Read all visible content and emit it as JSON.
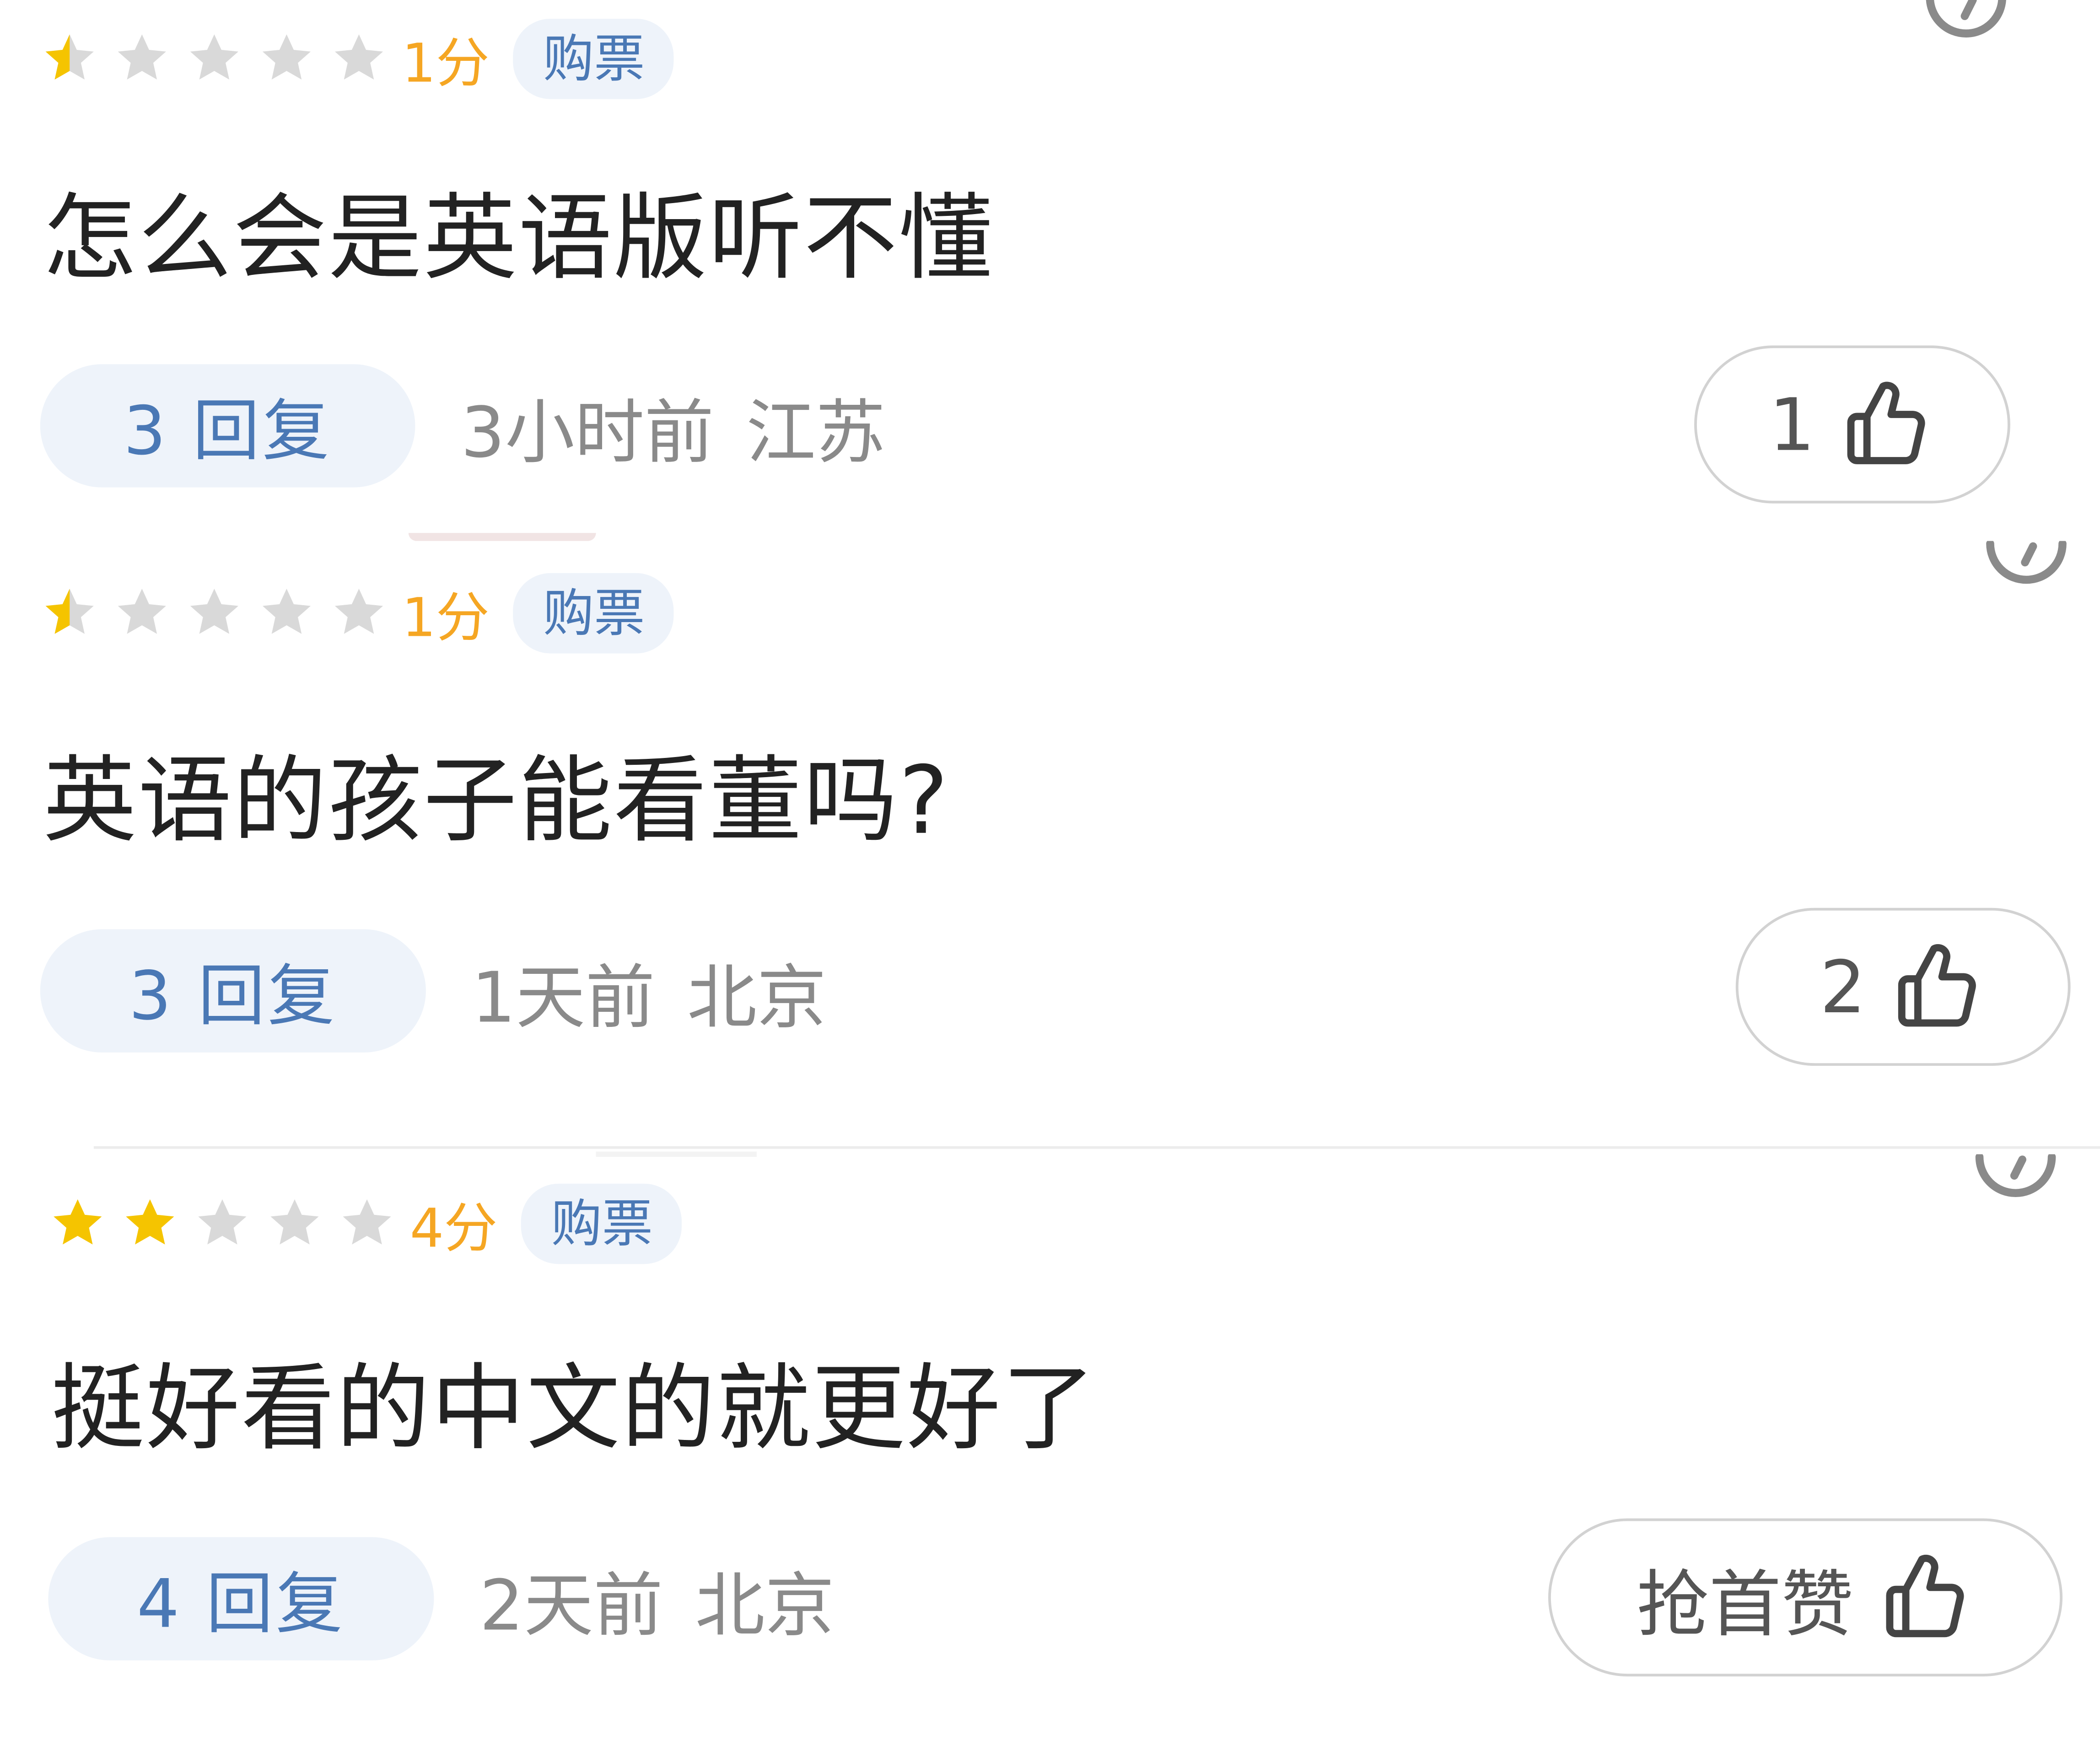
{
  "colors": {
    "star_filled": "#f5c400",
    "star_empty": "#d9d9d9",
    "score": "#f5a623",
    "tag_bg": "#eef3fa",
    "tag_text": "#4a78b5",
    "meta_text": "#8a8a8a",
    "content_text": "#222222"
  },
  "reviews": [
    {
      "rating": {
        "stars_filled": 0.5,
        "stars_total": 5,
        "score_label": "1分"
      },
      "tag": "购票",
      "content": "怎么会是英语版听不懂",
      "reply_label": "3 回复",
      "time": "3小时前",
      "location": "江苏",
      "like_label": "1",
      "icons": {
        "like": "thumb-up-icon",
        "more": "more-icon"
      }
    },
    {
      "rating": {
        "stars_filled": 0.5,
        "stars_total": 5,
        "score_label": "1分"
      },
      "tag": "购票",
      "content": "英语的孩子能看董吗?",
      "reply_label": "3 回复",
      "time": "1天前",
      "location": "北京",
      "like_label": "2",
      "icons": {
        "like": "thumb-up-icon",
        "more": "more-icon"
      }
    },
    {
      "rating": {
        "stars_filled": 2,
        "stars_total": 5,
        "score_label": "4分"
      },
      "tag": "购票",
      "content": "挺好看的中文的就更好了",
      "reply_label": "4 回复",
      "time": "2天前",
      "location": "北京",
      "like_label": "抢首赞",
      "icons": {
        "like": "thumb-up-icon",
        "more": "more-icon"
      }
    }
  ]
}
